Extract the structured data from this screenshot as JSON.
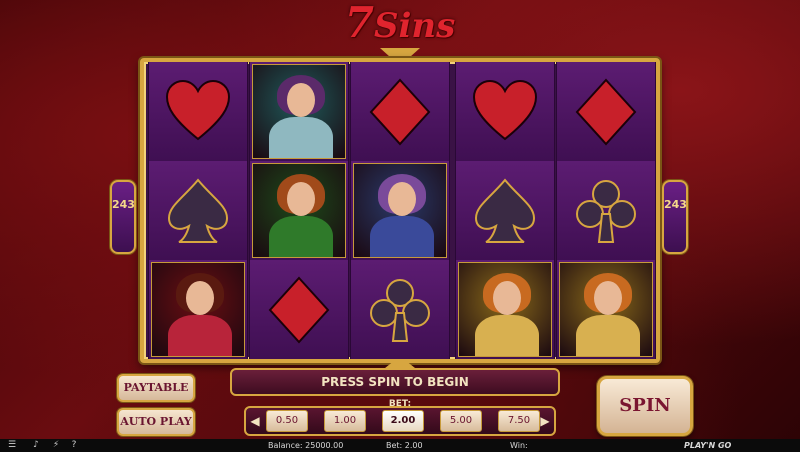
{
  "game": {
    "title_num": "7",
    "title_word": "Sins"
  },
  "ways": "243",
  "reels": [
    [
      "heart",
      "spade",
      "portrait-red"
    ],
    [
      "portrait-teal",
      "portrait-green",
      "diamond"
    ],
    [
      "diamond",
      "portrait-blue",
      "club"
    ],
    [
      "heart",
      "spade",
      "portrait-gold"
    ],
    [
      "diamond",
      "club",
      "portrait-gold"
    ]
  ],
  "message": "PRESS SPIN TO BEGIN",
  "buttons": {
    "paytable": "PAYTABLE",
    "autoplay": "AUTO PLAY",
    "spin": "SPIN"
  },
  "bet": {
    "label": "BET:",
    "options": [
      "0.50",
      "1.00",
      "2.00",
      "5.00",
      "7.50"
    ],
    "selected": "2.00"
  },
  "status": {
    "balance": "Balance: 25000.00",
    "bet": "Bet: 2.00",
    "win": "Win:",
    "brand": "PLAY'N GO"
  },
  "colors": {
    "gold": "#d7a640",
    "suit_red": "#c8202a",
    "suit_dark": "#3a2a44",
    "reel_purple": "#4a1460"
  }
}
